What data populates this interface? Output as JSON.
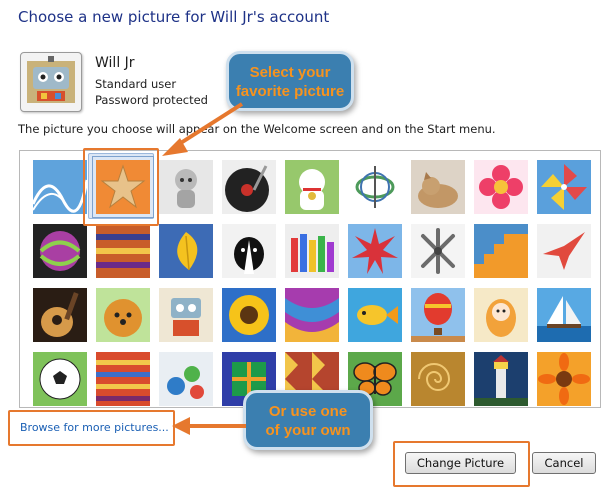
{
  "dialog": {
    "title": "Choose a new picture for Will Jr's account",
    "user_name": "Will Jr",
    "user_type": "Standard user",
    "password_status": "Password protected",
    "note": "The picture you choose will appear on the Welcome screen and on the Start menu."
  },
  "pictures": [
    {
      "name": "roller-coaster",
      "icon": "roller-coaster-icon"
    },
    {
      "name": "starfish",
      "icon": "starfish-icon",
      "selected": true
    },
    {
      "name": "robot-figure",
      "icon": "robot-figure-icon"
    },
    {
      "name": "vinyl-record",
      "icon": "vinyl-record-icon"
    },
    {
      "name": "lucky-cat",
      "icon": "lucky-cat-icon"
    },
    {
      "name": "gyroscope",
      "icon": "gyroscope-icon"
    },
    {
      "name": "kitten",
      "icon": "kitten-icon"
    },
    {
      "name": "flower",
      "icon": "flower-icon"
    },
    {
      "name": "pinwheel",
      "icon": "pinwheel-icon"
    },
    {
      "name": "ball",
      "icon": "ball-icon"
    },
    {
      "name": "fabric",
      "icon": "fabric-icon"
    },
    {
      "name": "leaf",
      "icon": "leaf-icon"
    },
    {
      "name": "dog",
      "icon": "dog-icon"
    },
    {
      "name": "crayons",
      "icon": "crayons-icon"
    },
    {
      "name": "star-lantern",
      "icon": "star-lantern-icon"
    },
    {
      "name": "jacks",
      "icon": "jacks-icon"
    },
    {
      "name": "stairs",
      "icon": "stairs-icon"
    },
    {
      "name": "paper-crane",
      "icon": "paper-crane-icon"
    },
    {
      "name": "guitar",
      "icon": "guitar-icon"
    },
    {
      "name": "pomeranian",
      "icon": "pomeranian-icon"
    },
    {
      "name": "toy-robot",
      "icon": "toy-robot-icon"
    },
    {
      "name": "sunflower",
      "icon": "sunflower-icon"
    },
    {
      "name": "textile",
      "icon": "textile-icon"
    },
    {
      "name": "fish",
      "icon": "fish-icon"
    },
    {
      "name": "hot-air-balloon",
      "icon": "hot-air-balloon-icon"
    },
    {
      "name": "doll",
      "icon": "doll-icon"
    },
    {
      "name": "sailboat",
      "icon": "sailboat-icon"
    },
    {
      "name": "soccer-ball",
      "icon": "soccer-ball-icon"
    },
    {
      "name": "striped-fabric",
      "icon": "striped-fabric-icon"
    },
    {
      "name": "marbles",
      "icon": "marbles-icon"
    },
    {
      "name": "window-frame",
      "icon": "window-frame-icon"
    },
    {
      "name": "textile-pattern",
      "icon": "textile-pattern-icon"
    },
    {
      "name": "butterfly",
      "icon": "butterfly-icon"
    },
    {
      "name": "spiral-shell",
      "icon": "spiral-shell-icon"
    },
    {
      "name": "lighthouse",
      "icon": "lighthouse-icon"
    },
    {
      "name": "gerbera",
      "icon": "gerbera-icon"
    }
  ],
  "browse_link": "Browse for more pictures...",
  "buttons": {
    "change": "Change Picture",
    "cancel": "Cancel"
  },
  "callouts": {
    "top": [
      "Select your",
      "favorite picture"
    ],
    "bottom": [
      "Or use one",
      "of your own"
    ]
  },
  "colors": {
    "title": "#1e3287",
    "link": "#1a5fb4",
    "callout_fill": "#3b7fb0",
    "callout_text": "#f7931e",
    "highlight": "#e6782e"
  }
}
